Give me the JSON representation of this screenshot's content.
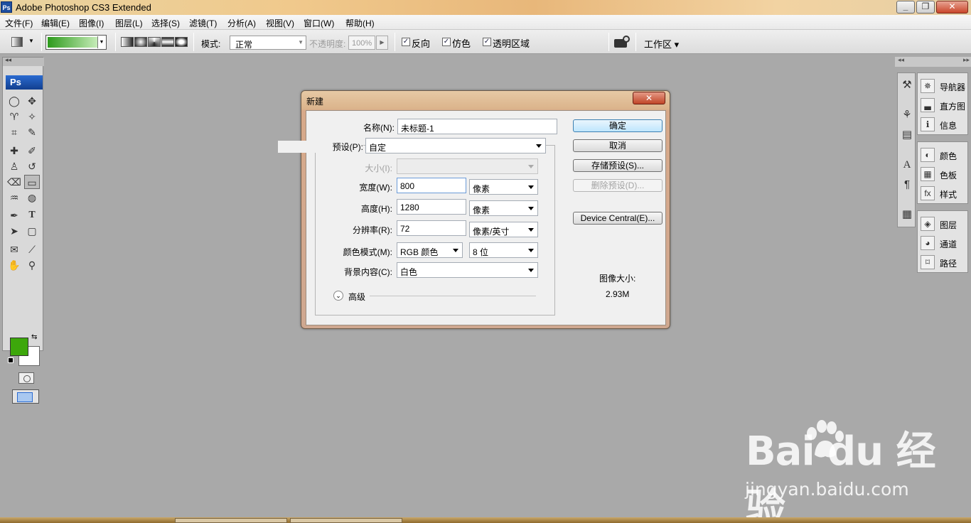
{
  "window": {
    "title": "Adobe Photoshop CS3 Extended",
    "app_icon": "Ps"
  },
  "menu": [
    "文件(F)",
    "编辑(E)",
    "图像(I)",
    "图层(L)",
    "选择(S)",
    "滤镜(T)",
    "分析(A)",
    "视图(V)",
    "窗口(W)",
    "帮助(H)"
  ],
  "options": {
    "mode_label": "模式:",
    "mode_value": "正常",
    "opacity_label": "不透明度:",
    "opacity_value": "100%",
    "reverse_label": "反向",
    "dither_label": "仿色",
    "transparency_label": "透明区域",
    "workspace_label": "工作区 ▾",
    "gradient_color_start": "#2d9a1c",
    "gradient_color_end": "#c6ecb8"
  },
  "toolbox": {
    "logo": "Ps",
    "foreground_color": "#3da70b",
    "background_color": "#ffffff"
  },
  "panels": {
    "group1": [
      "导航器",
      "直方图",
      "信息"
    ],
    "group2": [
      "颜色",
      "色板",
      "样式"
    ],
    "group3": [
      "图层",
      "通道",
      "路径"
    ]
  },
  "dialog": {
    "title": "新建",
    "close": "✕",
    "name_label": "名称(N):",
    "name_value": "未标题-1",
    "preset_label": "预设(P):",
    "preset_value": "自定",
    "size_label": "大小(I):",
    "width_label": "宽度(W):",
    "width_value": "800",
    "width_unit": "像素",
    "height_label": "高度(H):",
    "height_value": "1280",
    "height_unit": "像素",
    "resolution_label": "分辨率(R):",
    "resolution_value": "72",
    "resolution_unit": "像素/英寸",
    "colormode_label": "颜色模式(M):",
    "colormode_value": "RGB 颜色",
    "bitdepth_value": "8 位",
    "background_label": "背景内容(C):",
    "background_value": "白色",
    "advanced_label": "高级",
    "buttons": {
      "ok": "确定",
      "cancel": "取消",
      "save_preset": "存储预设(S)...",
      "delete_preset": "删除预设(D)...",
      "device_central": "Device Central(E)..."
    },
    "image_size_label": "图像大小:",
    "image_size_value": "2.93M"
  },
  "watermark": {
    "brand": "Bai du 经验",
    "url": "jingyan.baidu.com"
  }
}
